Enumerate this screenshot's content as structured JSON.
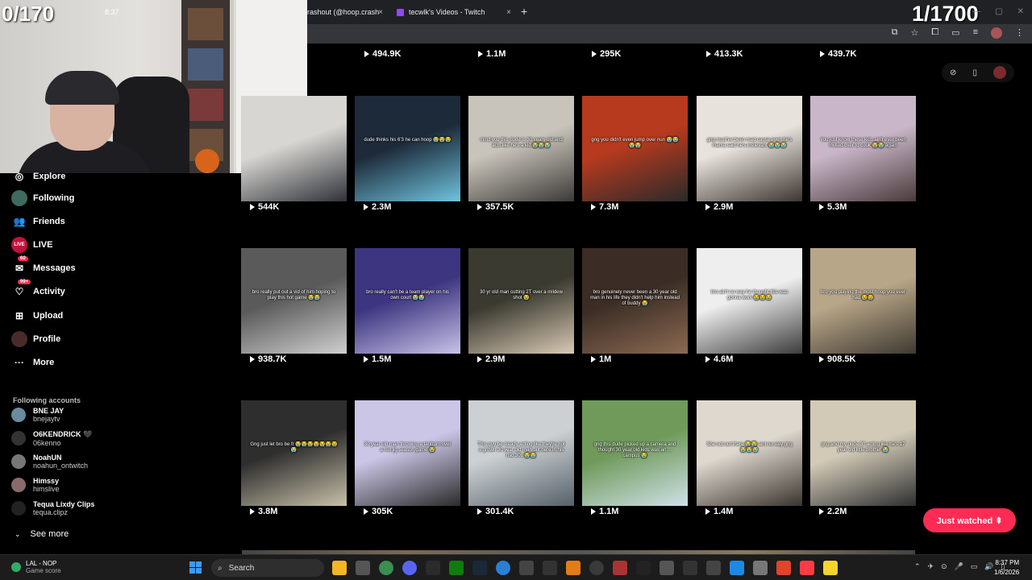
{
  "browser": {
    "tabs": [
      {
        "label": "rashout (@hoop.crash"
      },
      {
        "label": "tecwlk's Videos - Twitch"
      }
    ],
    "close_glyph": "×",
    "new_tab_glyph": "+"
  },
  "overlay": {
    "left_counter": "0/170",
    "right_counter": "1/1700",
    "cam_time": "8:37"
  },
  "sidebar": {
    "nav": [
      {
        "label": "Explore",
        "icon": "compass-icon",
        "glyph": "◎"
      },
      {
        "label": "Following",
        "icon": "following-avatar-icon",
        "glyph": ""
      },
      {
        "label": "Friends",
        "icon": "friends-icon",
        "glyph": "👥"
      },
      {
        "label": "LIVE",
        "icon": "live-icon",
        "glyph": "LIVE"
      },
      {
        "label": "Messages",
        "icon": "messages-icon",
        "glyph": "✉",
        "badge": "60"
      },
      {
        "label": "Activity",
        "icon": "activity-icon",
        "glyph": "♡",
        "badge": "99+"
      },
      {
        "label": "Upload",
        "icon": "upload-icon",
        "glyph": "⊞"
      },
      {
        "label": "Profile",
        "icon": "profile-avatar-icon",
        "glyph": ""
      },
      {
        "label": "More",
        "icon": "more-icon",
        "glyph": "···"
      }
    ],
    "following_title": "Following accounts",
    "following": [
      {
        "name": "BNE JAY",
        "handle": "bnejaytv"
      },
      {
        "name": "O6KENDRICK 🖤",
        "handle": "06kenno"
      },
      {
        "name": "NoahUN",
        "handle": "noahun_ontwitch"
      },
      {
        "name": "Himssy",
        "handle": "himslive"
      },
      {
        "name": "Tequa Lixdy Clips",
        "handle": "tequa.clipz"
      }
    ],
    "see_more": "See more",
    "see_more_icon": "⌄"
  },
  "grid": {
    "top_counts": [
      "494.9K",
      "1.1M",
      "295K",
      "413.3K",
      "439.7K"
    ],
    "rows": [
      [
        {
          "views": "544K",
          "caption": ""
        },
        {
          "views": "2.3M",
          "caption": "dude thinks his 6'3 he can hoop 😭😭😭"
        },
        {
          "views": "357.5K",
          "caption": "mind you this dude is 30 years old and acts like he's a kid 😭😭😭"
        },
        {
          "views": "7.3M",
          "caption": "gng you didn't even jump over nun 😭😭😭😭"
        },
        {
          "views": "2.9M",
          "caption": "gng must've been mad cause even he's mama said he's irrelevant 😭😭😭"
        },
        {
          "views": "5.3M",
          "caption": "You just know these kids ain't ever been invited over to cook 😭😭 again"
        }
      ],
      [
        {
          "views": "938.7K",
          "caption": "bro really put out a vid of him hoping to play this hot game 😭😭"
        },
        {
          "views": "1.5M",
          "caption": "bro really can't be a team player on his own court 😭😭"
        },
        {
          "views": "2.9M",
          "caption": "30 yr old man cutting 2T over a mildew shot 😭"
        },
        {
          "views": "1M",
          "caption": "bro genuinely never been a 30 year old man in his life they didn't help him instead of buddy 😭"
        },
        {
          "views": "4.6M",
          "caption": "bro ain't no way he thought this was gonna work 😭😭😭"
        },
        {
          "views": "908.5K",
          "caption": "bro you playing the most hoop you ever had 😭😭"
        }
      ],
      [
        {
          "views": "3.8M",
          "caption": "Gng just let bro be fr 😭😭😭😭😭😭😭😭"
        },
        {
          "views": "305K",
          "caption": "30 year old man throwing a tantrum over a red jig season game 😭"
        },
        {
          "views": "301.4K",
          "caption": "This guy be steady acting like they're not a grown 30 year old man out here in his mid 30s 😭😭"
        },
        {
          "views": "1.1M",
          "caption": "gng this dude picked up a camera and thought 30 year old kids was an ... campus 😭"
        },
        {
          "views": "1.4M",
          "caption": "She not out there 😭😭 aint no way gng 😭😭😭"
        },
        {
          "views": "2.2M",
          "caption": "gng and my dude 30 acting like he's 17 year old little brother 😭"
        }
      ]
    ]
  },
  "right_panel": {
    "icons": [
      "shield-icon",
      "phone-icon",
      "profile-avatar-icon"
    ],
    "glyphs": [
      "⊘",
      "▯"
    ]
  },
  "just_watched": "Just watched ⇞",
  "taskbar": {
    "weather_title": "LAL - NOP",
    "weather_sub": "Game score",
    "search": "Search",
    "search_glyph": "⌕",
    "tray_glyphs": [
      "⌃",
      "✈",
      "⊙",
      "🎤",
      "▭",
      "🔊",
      "▯"
    ],
    "time": "8:37 PM",
    "date": "1/6/2026"
  },
  "colors": {
    "accent": "#fe2c55",
    "twitch": "#9146ff",
    "windows_blue": "#3b9cf5"
  }
}
